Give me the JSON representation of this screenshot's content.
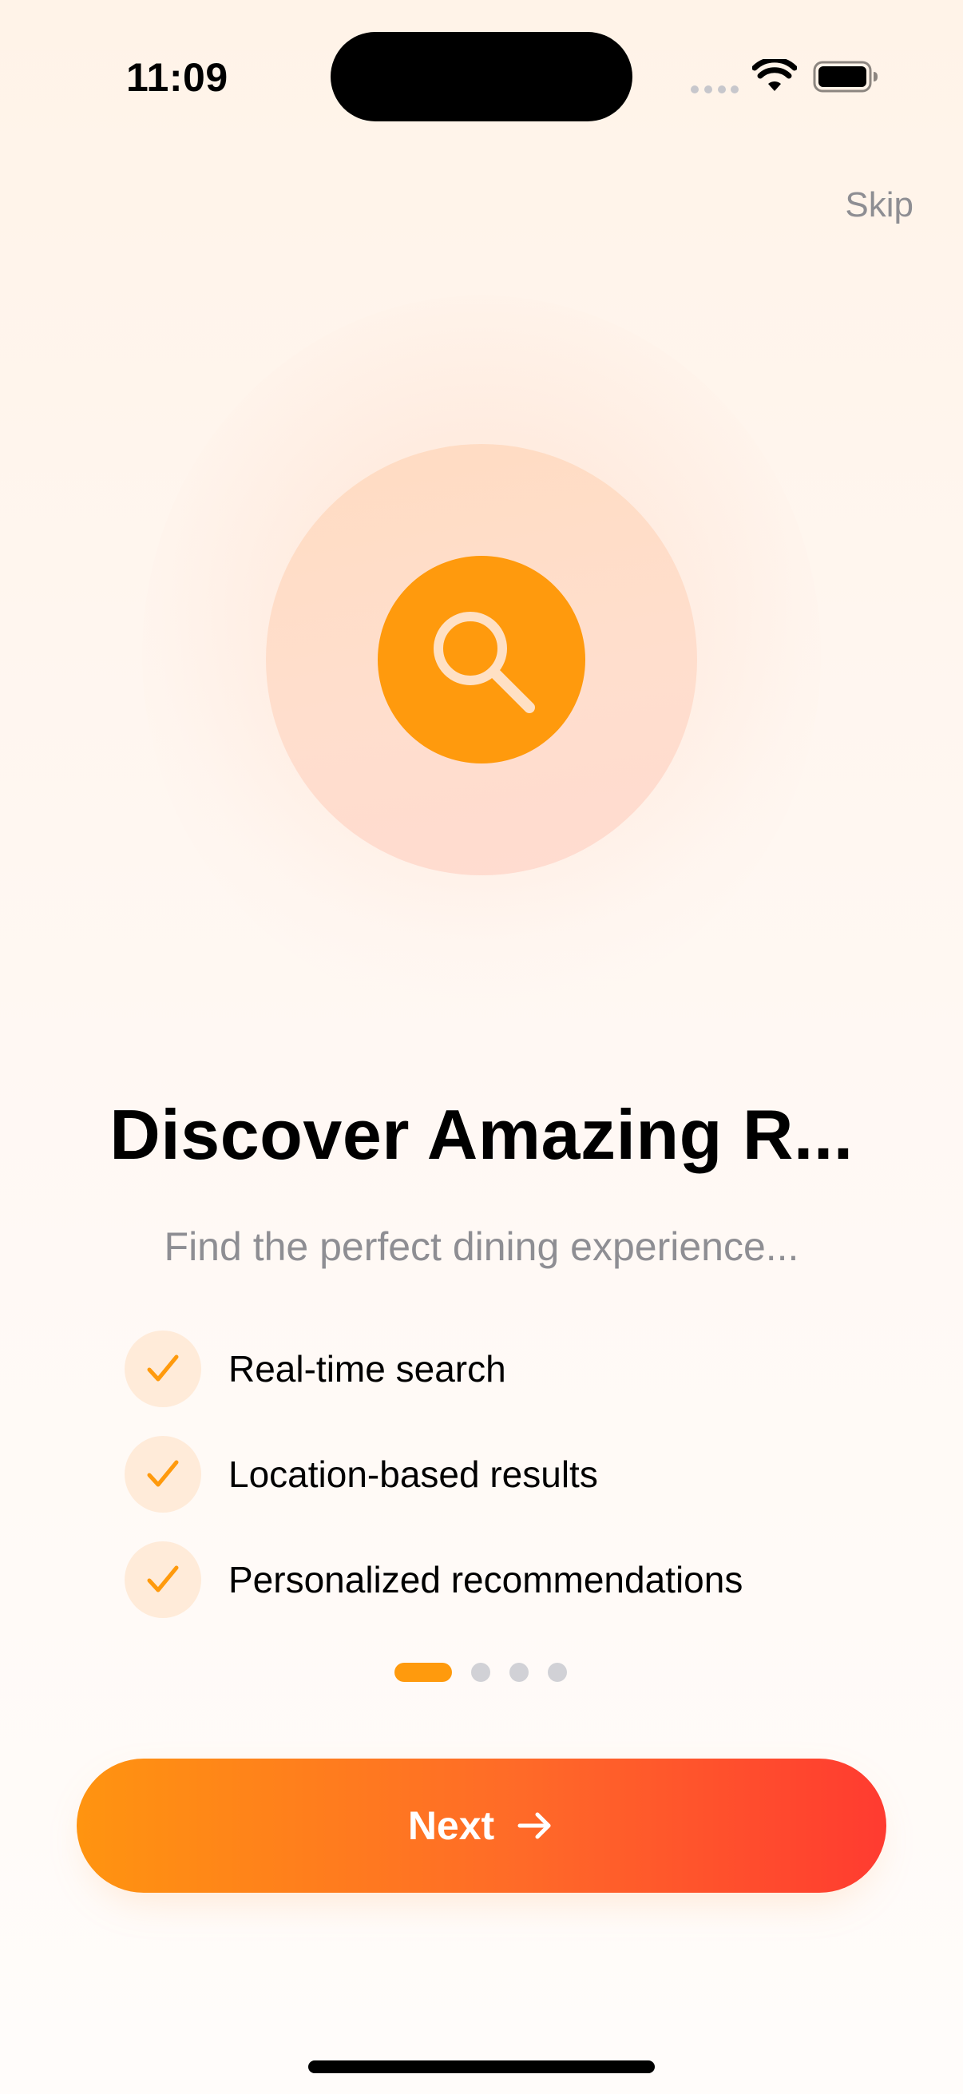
{
  "status_bar": {
    "time": "11:09"
  },
  "header": {
    "skip_label": "Skip"
  },
  "hero": {
    "icon": "search-icon"
  },
  "content": {
    "title": "Discover Amazing R...",
    "subtitle": "Find the perfect dining experience...",
    "features": [
      {
        "label": "Real-time search",
        "icon": "checkmark-icon"
      },
      {
        "label": "Location-based results",
        "icon": "checkmark-icon"
      },
      {
        "label": "Personalized recommendations",
        "icon": "checkmark-icon"
      }
    ]
  },
  "pager": {
    "total_pages": 4,
    "current_page": 1
  },
  "footer": {
    "next_label": "Next",
    "next_icon": "arrow-right-icon"
  },
  "colors": {
    "accent": "#FF9A0D",
    "gradient_start": "#FF9410",
    "gradient_end": "#FF3B30",
    "secondary_text": "#8E8E93",
    "inactive_dot": "#D1D1D6"
  }
}
